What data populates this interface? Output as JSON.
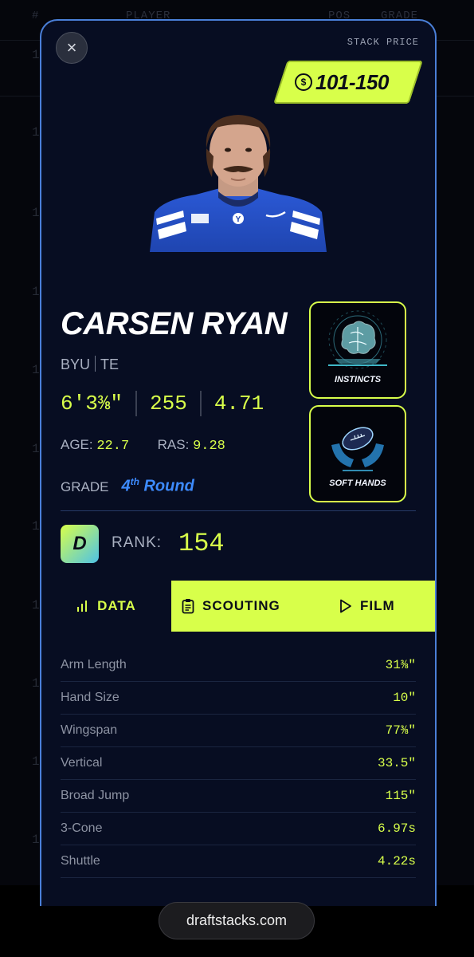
{
  "background_table": {
    "headers": [
      "#",
      "PLAYER",
      "POS",
      "GRADE"
    ],
    "row_numbers": [
      "1",
      "1",
      "1",
      "1",
      "1",
      "1",
      "1",
      "1",
      "1",
      "1",
      "1",
      "1",
      "1",
      "1"
    ]
  },
  "card": {
    "close_symbol": "×",
    "stack_price_label": "STACK PRICE",
    "stack_price_value": "101-150",
    "player": {
      "name": "CARSEN RYAN",
      "school": "BYU",
      "position": "TE",
      "height": "6'3⅜\"",
      "weight": "255",
      "forty": "4.71",
      "age_label": "AGE:",
      "age": "22.7",
      "ras_label": "RAS:",
      "ras": "9.28",
      "grade_label": "GRADE",
      "grade_num": "4",
      "grade_sup": "th",
      "grade_word": "Round",
      "jersey_text": "Y"
    },
    "badges": [
      {
        "label": "INSTINCTS",
        "icon": "brain-icon"
      },
      {
        "label": "SOFT HANDS",
        "icon": "football-hands-icon"
      }
    ],
    "rank": {
      "tier": "D",
      "label": "RANK:",
      "value": "154"
    },
    "tabs": {
      "data": "DATA",
      "scouting": "SCOUTING",
      "film": "FILM"
    },
    "stats": [
      {
        "label": "Arm Length",
        "value": "31⅜\""
      },
      {
        "label": "Hand Size",
        "value": "10\""
      },
      {
        "label": "Wingspan",
        "value": "77⅜\""
      },
      {
        "label": "Vertical",
        "value": "33.5\""
      },
      {
        "label": "Broad Jump",
        "value": "115\""
      },
      {
        "label": "3-Cone",
        "value": "6.97s"
      },
      {
        "label": "Shuttle",
        "value": "4.22s"
      }
    ]
  },
  "footer": {
    "site": "draftstacks.com"
  },
  "colors": {
    "accent": "#d8ff4a",
    "grade_blue": "#3d8bff",
    "card_bg": "#070d22",
    "border": "#4a7fd8"
  }
}
